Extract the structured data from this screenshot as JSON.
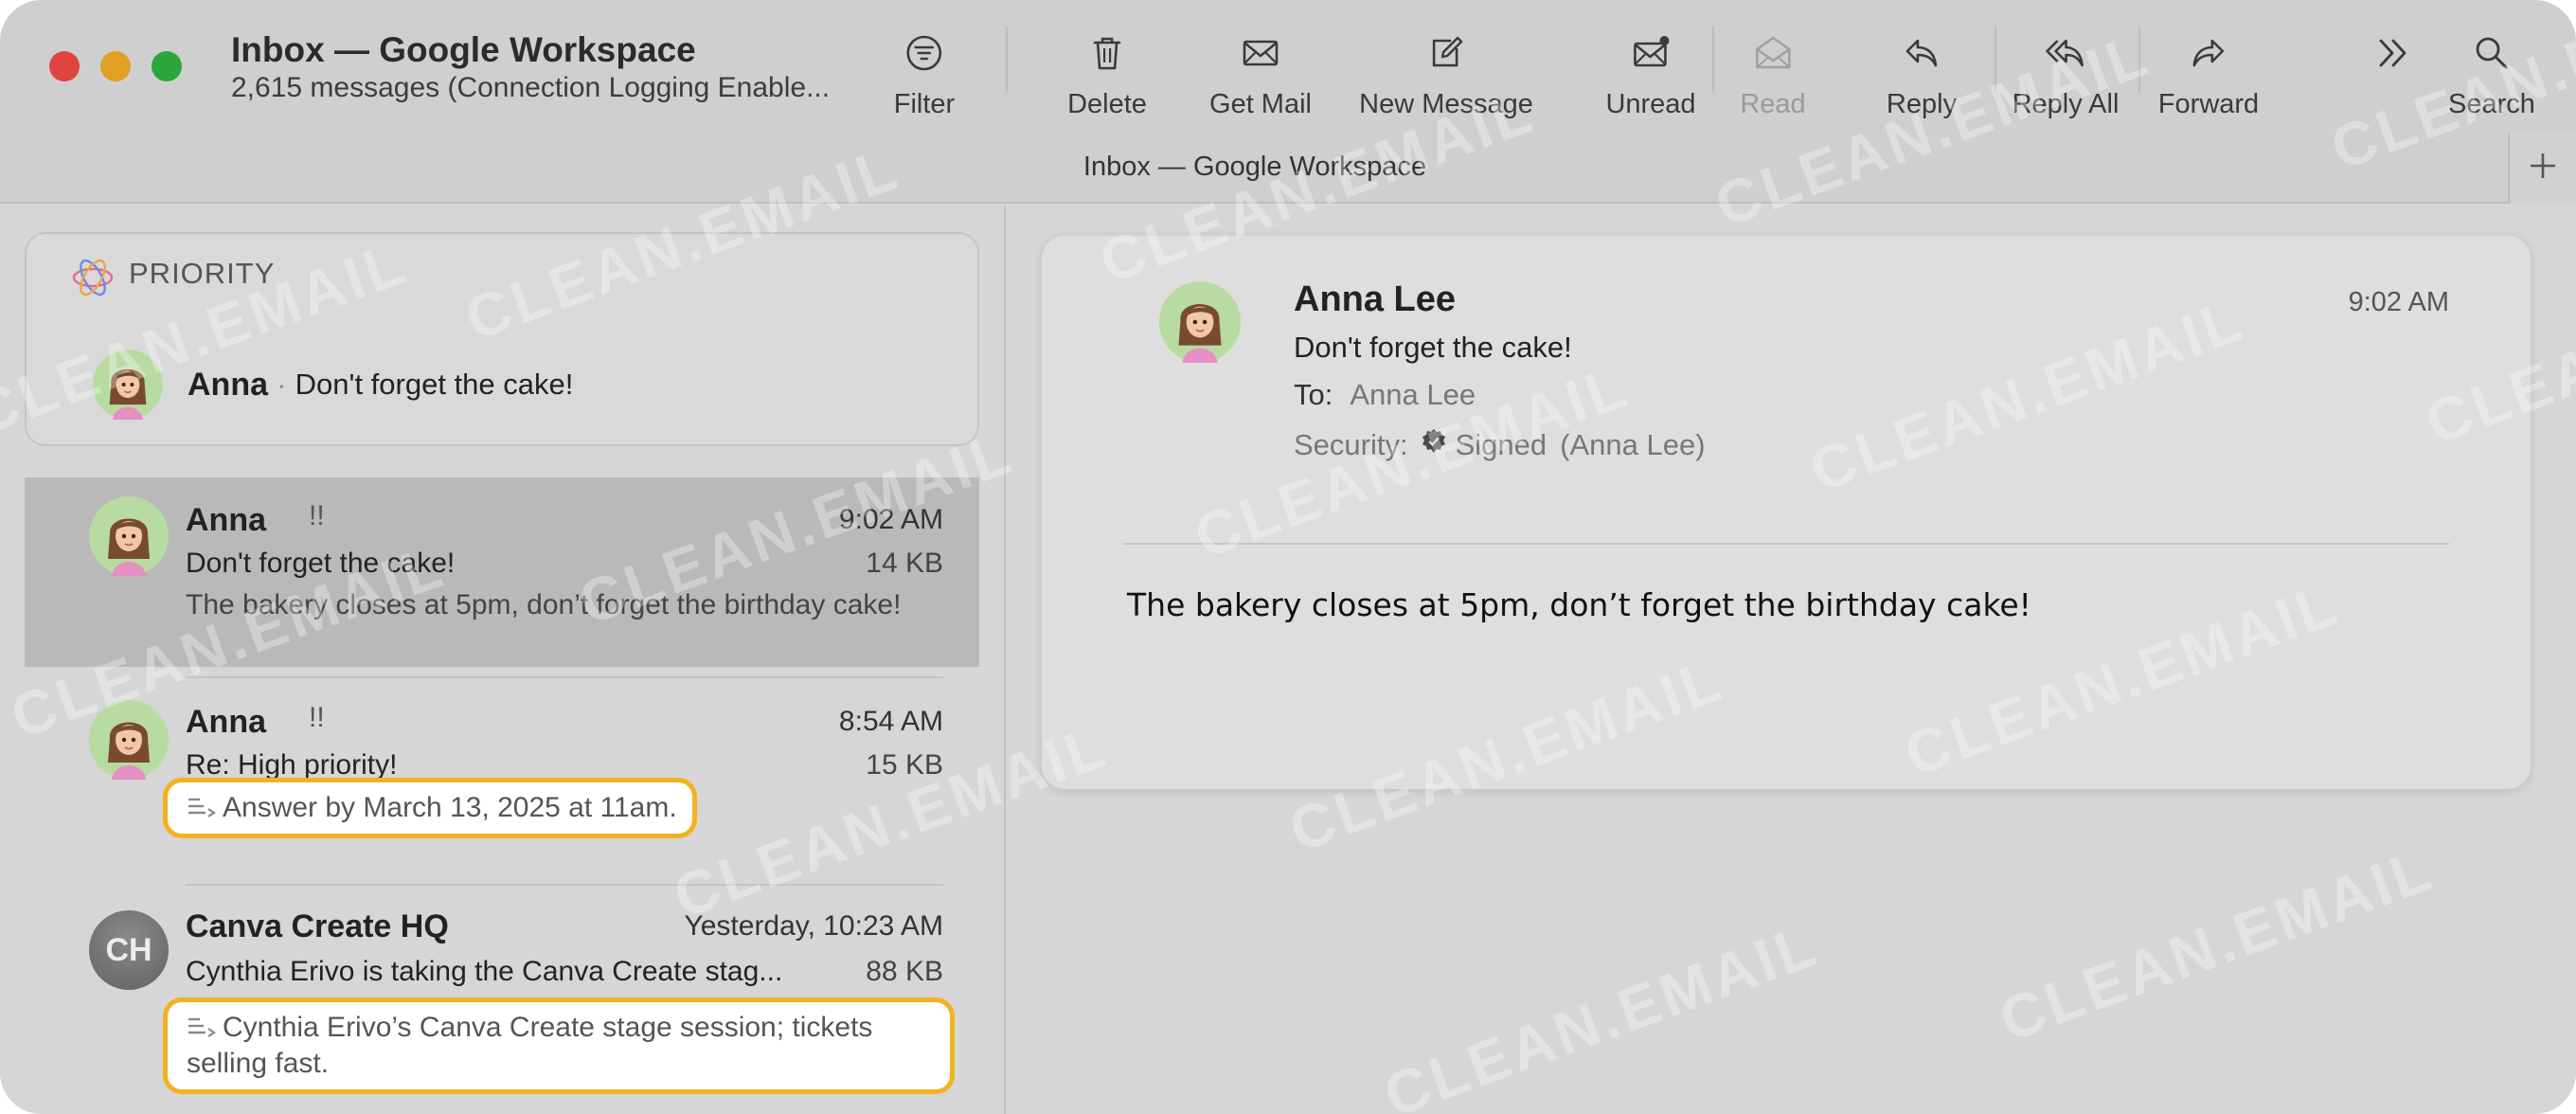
{
  "window": {
    "title": "Inbox — Google Workspace",
    "subtitle": "2,615 messages (Connection Logging Enable...",
    "tab_title": "Inbox — Google Workspace"
  },
  "toolbar": {
    "filter": "Filter",
    "delete": "Delete",
    "get_mail": "Get Mail",
    "new_message": "New Message",
    "unread": "Unread",
    "read": "Read",
    "reply": "Reply",
    "reply_all": "Reply All",
    "forward": "Forward",
    "search": "Search"
  },
  "priority": {
    "label": "PRIORITY",
    "sender": "Anna",
    "separator": "·",
    "subject": "Don't forget the cake!"
  },
  "messages": [
    {
      "sender": "Anna",
      "flag": "!!",
      "time": "9:02 AM",
      "subject": "Don't forget the cake!",
      "size": "14 KB",
      "preview": "The bakery closes at 5pm, don’t forget the birthday cake!"
    },
    {
      "sender": "Anna",
      "flag": "!!",
      "time": "8:54 AM",
      "subject": "Re: High priority!",
      "size": "15 KB",
      "summary": "Answer by March 13, 2025 at 11am."
    },
    {
      "sender": "Canva Create HQ",
      "avatar_initials": "CH",
      "time": "Yesterday, 10:23 AM",
      "subject": "Cynthia Erivo is taking the Canva Create stag...",
      "size": "88 KB",
      "summary": "Cynthia Erivo’s Canva Create stage session; tickets selling fast."
    }
  ],
  "reading": {
    "sender": "Anna Lee",
    "time": "9:02 AM",
    "subject": "Don't forget the cake!",
    "to_label": "To:",
    "to_value": "Anna Lee",
    "security_label": "Security:",
    "security_value": "Signed",
    "security_who": "(Anna Lee)",
    "body": "The bakery closes at 5pm, don’t forget the birthday cake!"
  },
  "watermark": "CLEAN.EMAIL",
  "colors": {
    "highlight_border": "#f4b120",
    "selected_row": "#b9b9b9",
    "close": "#e0443e",
    "minimize": "#dea123",
    "zoom": "#2aa73c"
  }
}
